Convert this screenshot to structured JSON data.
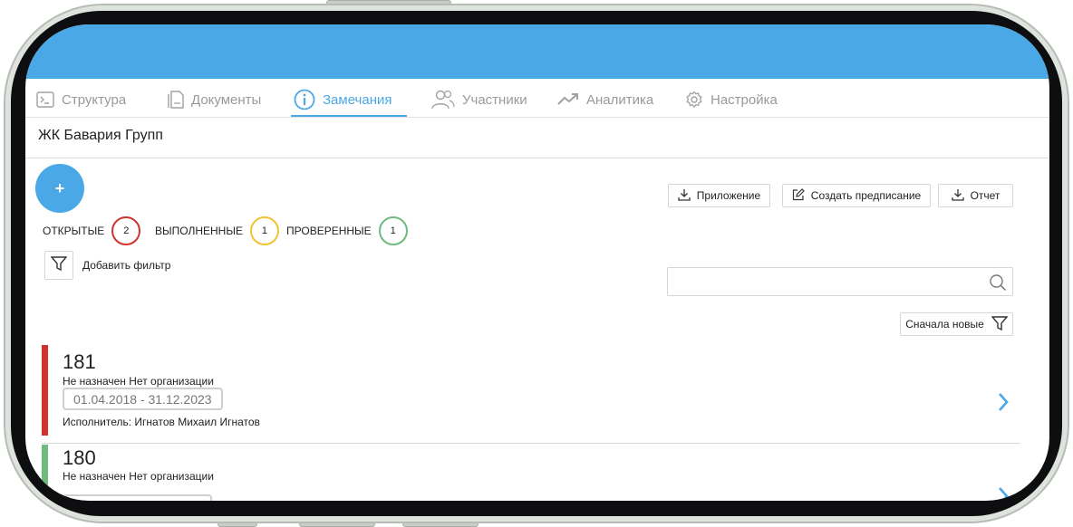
{
  "tabs": [
    {
      "label": "Структура",
      "icon": "terminal-icon",
      "active": false
    },
    {
      "label": "Документы",
      "icon": "document-icon",
      "active": false
    },
    {
      "label": "Замечания",
      "icon": "info-icon",
      "active": true
    },
    {
      "label": "Участники",
      "icon": "users-icon",
      "active": false
    },
    {
      "label": "Аналитика",
      "icon": "trend-icon",
      "active": false
    },
    {
      "label": "Настройка",
      "icon": "gear-icon",
      "active": false
    }
  ],
  "project_title": "ЖК Бавария Групп",
  "fab_label": "+",
  "actions": {
    "attachment": "Приложение",
    "create_order": "Создать предписание",
    "report": "Отчет"
  },
  "statuses": [
    {
      "label": "ОТКРЫТЫЕ",
      "count": "2",
      "color": "#d0332e"
    },
    {
      "label": "ВЫПОЛНЕННЫЕ",
      "count": "1",
      "color": "#f2c230"
    },
    {
      "label": "ПРОВЕРЕННЫЕ",
      "count": "1",
      "color": "#6fba7d"
    }
  ],
  "filter_label": "Добавить фильтр",
  "search": {
    "placeholder": "",
    "value": ""
  },
  "sort_label": "Сначала новые",
  "items": [
    {
      "number": "181",
      "subtitle": "Не назначен Нет организации",
      "dates": "01.04.2018 - 31.12.2023",
      "executor": "Исполнитель: Игнатов Михаил Игнатов",
      "status_color": "#d0332e"
    },
    {
      "number": "180",
      "subtitle": "Не назначен Нет организации",
      "status_color": "#6fba7d"
    }
  ],
  "colors": {
    "accent": "#4aa8e6"
  }
}
